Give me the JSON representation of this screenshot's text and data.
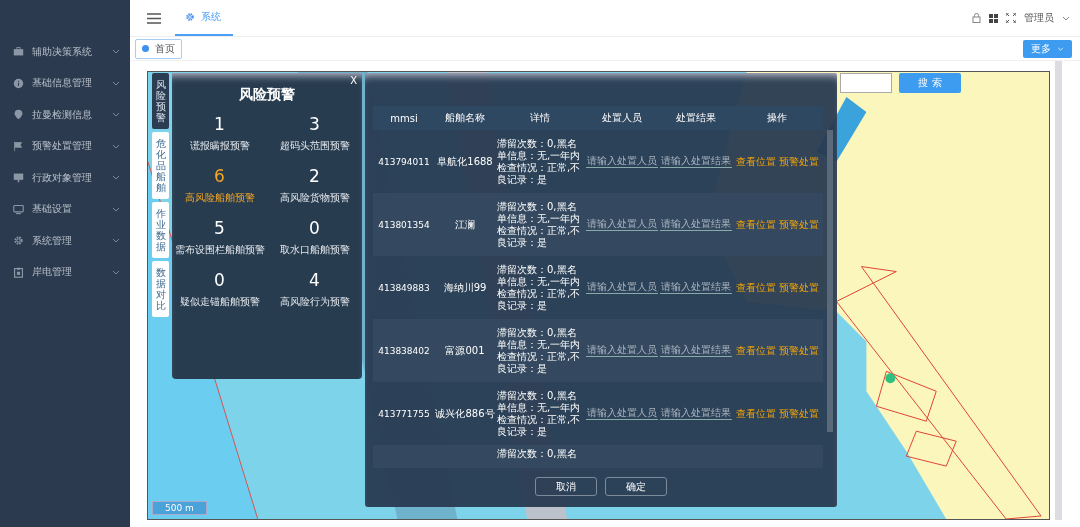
{
  "sidebar": {
    "items": [
      {
        "label": "辅助决策系统"
      },
      {
        "label": "基础信息管理"
      },
      {
        "label": "拉曼检测信息"
      },
      {
        "label": "预警处置管理"
      },
      {
        "label": "行政对象管理"
      },
      {
        "label": "基础设置"
      },
      {
        "label": "系统管理"
      },
      {
        "label": "岸电管理"
      }
    ]
  },
  "header": {
    "tab": "系统",
    "user": "管理员"
  },
  "page_tabs": [
    {
      "label": "首页",
      "selected": true
    }
  ],
  "more_button": "更多",
  "search_button": "搜 索",
  "scale": "500 m",
  "side_tabs": [
    {
      "label": "风险预警",
      "selected": true
    },
    {
      "label": "危化品船舶",
      "selected": false
    },
    {
      "label": "作业数据",
      "selected": false
    },
    {
      "label": "数据对比",
      "selected": false
    }
  ],
  "risk_panel": {
    "title": "风险预警",
    "close": "X",
    "stats": [
      {
        "value": "1",
        "label": "谎报瞒报预警",
        "selected": false
      },
      {
        "value": "3",
        "label": "超码头范围预警",
        "selected": false
      },
      {
        "value": "6",
        "label": "高风险船舶预警",
        "selected": true
      },
      {
        "value": "2",
        "label": "高风险货物预警",
        "selected": false
      },
      {
        "value": "5",
        "label": "需布设围栏船舶预警",
        "selected": false
      },
      {
        "value": "0",
        "label": "取水口船舶预警",
        "selected": false
      },
      {
        "value": "0",
        "label": "疑似走锚船舶预警",
        "selected": false
      },
      {
        "value": "4",
        "label": "高风险行为预警",
        "selected": false
      }
    ]
  },
  "table": {
    "columns": [
      "mmsi",
      "船舶名称",
      "详情",
      "处置人员",
      "处置结果",
      "操作"
    ],
    "rows": [
      {
        "mmsi": "413794011",
        "name": "阜航化1688",
        "details": "滞留次数：0,黑名单信息：无,一年内检查情况：正常,不良记录：是",
        "person_placeholder": "请输入处置人员",
        "result_placeholder": "请输入处置结果",
        "actions": [
          "查看位置",
          "预警处置"
        ]
      },
      {
        "mmsi": "413801354",
        "name": "江澜",
        "details": "滞留次数：0,黑名单信息：无,一年内检查情况：正常,不良记录：是",
        "person_placeholder": "请输入处置人员",
        "result_placeholder": "请输入处置结果",
        "actions": [
          "查看位置",
          "预警处置"
        ]
      },
      {
        "mmsi": "413849883",
        "name": "海纳川99",
        "details": "滞留次数：0,黑名单信息：无,一年内检查情况：正常,不良记录：是",
        "person_placeholder": "请输入处置人员",
        "result_placeholder": "请输入处置结果",
        "actions": [
          "查看位置",
          "预警处置"
        ]
      },
      {
        "mmsi": "413838402",
        "name": "富源001",
        "details": "滞留次数：0,黑名单信息：无,一年内检查情况：正常,不良记录：是",
        "person_placeholder": "请输入处置人员",
        "result_placeholder": "请输入处置结果",
        "actions": [
          "查看位置",
          "预警处置"
        ]
      },
      {
        "mmsi": "413771755",
        "name": "诚兴化886号",
        "details": "滞留次数：0,黑名单信息：无,一年内检查情况：正常,不良记录：是",
        "person_placeholder": "请输入处置人员",
        "result_placeholder": "请输入处置结果",
        "actions": [
          "查看位置",
          "预警处置"
        ]
      }
    ],
    "partial_row": {
      "details": "滞留次数：0,黑名"
    }
  },
  "buttons": [
    "取消",
    "确定"
  ]
}
